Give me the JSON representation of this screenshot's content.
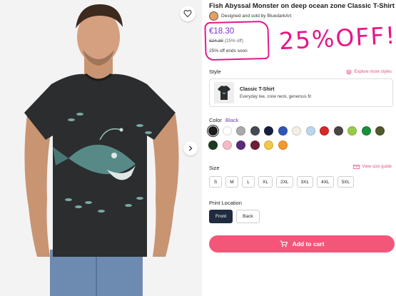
{
  "product": {
    "title": "Fish Abyssal Monster on deep ocean zone Classic T-Shirt",
    "seller": "Designed and sold by BluedarkArt",
    "price": "€18.30",
    "old_price": "€24.39",
    "discount": "(25% off)",
    "sale_text": "25% off ends soon",
    "promo_overlay": "25%OFF!"
  },
  "style": {
    "label": "Style",
    "explore_label": "Explore more styles",
    "name": "Classic T-Shirt",
    "description": "Everyday tee, crew neck, generous fit"
  },
  "color": {
    "label": "Color",
    "selected": "Black",
    "swatches": [
      {
        "name": "black",
        "hex": "#1c1c1c"
      },
      {
        "name": "white",
        "hex": "#ffffff"
      },
      {
        "name": "light-grey",
        "hex": "#a9a9a9"
      },
      {
        "name": "dark-grey",
        "hex": "#454a52"
      },
      {
        "name": "navy",
        "hex": "#16203e"
      },
      {
        "name": "royal-blue",
        "hex": "#2e55b8"
      },
      {
        "name": "cream",
        "hex": "#f2efe4"
      },
      {
        "name": "light-blue",
        "hex": "#bcd6ee"
      },
      {
        "name": "red",
        "hex": "#d42a2a"
      },
      {
        "name": "charcoal",
        "hex": "#4a4545"
      },
      {
        "name": "lime",
        "hex": "#9ac94a"
      },
      {
        "name": "kelly-green",
        "hex": "#1a8f3c"
      },
      {
        "name": "olive",
        "hex": "#4e5a2e"
      },
      {
        "name": "forest-green",
        "hex": "#1f3a22"
      },
      {
        "name": "pink",
        "hex": "#f4bcc6"
      },
      {
        "name": "purple",
        "hex": "#5a2a7a"
      },
      {
        "name": "maroon",
        "hex": "#6e1f33"
      },
      {
        "name": "yellow",
        "hex": "#f2c84a"
      },
      {
        "name": "orange",
        "hex": "#f29a2a"
      }
    ]
  },
  "size": {
    "label": "Size",
    "guide_label": "View size guide",
    "options": [
      "S",
      "M",
      "L",
      "XL",
      "2XL",
      "3XL",
      "4XL",
      "5XL"
    ]
  },
  "print_location": {
    "label": "Print Location",
    "options": [
      "Front",
      "Back"
    ],
    "selected": "Front"
  },
  "cart": {
    "label": "Add to cart"
  },
  "colors": {
    "accent": "#e4527c",
    "price": "#7a32c8",
    "annotation": "#e4178c",
    "cart": "#f2577a"
  }
}
